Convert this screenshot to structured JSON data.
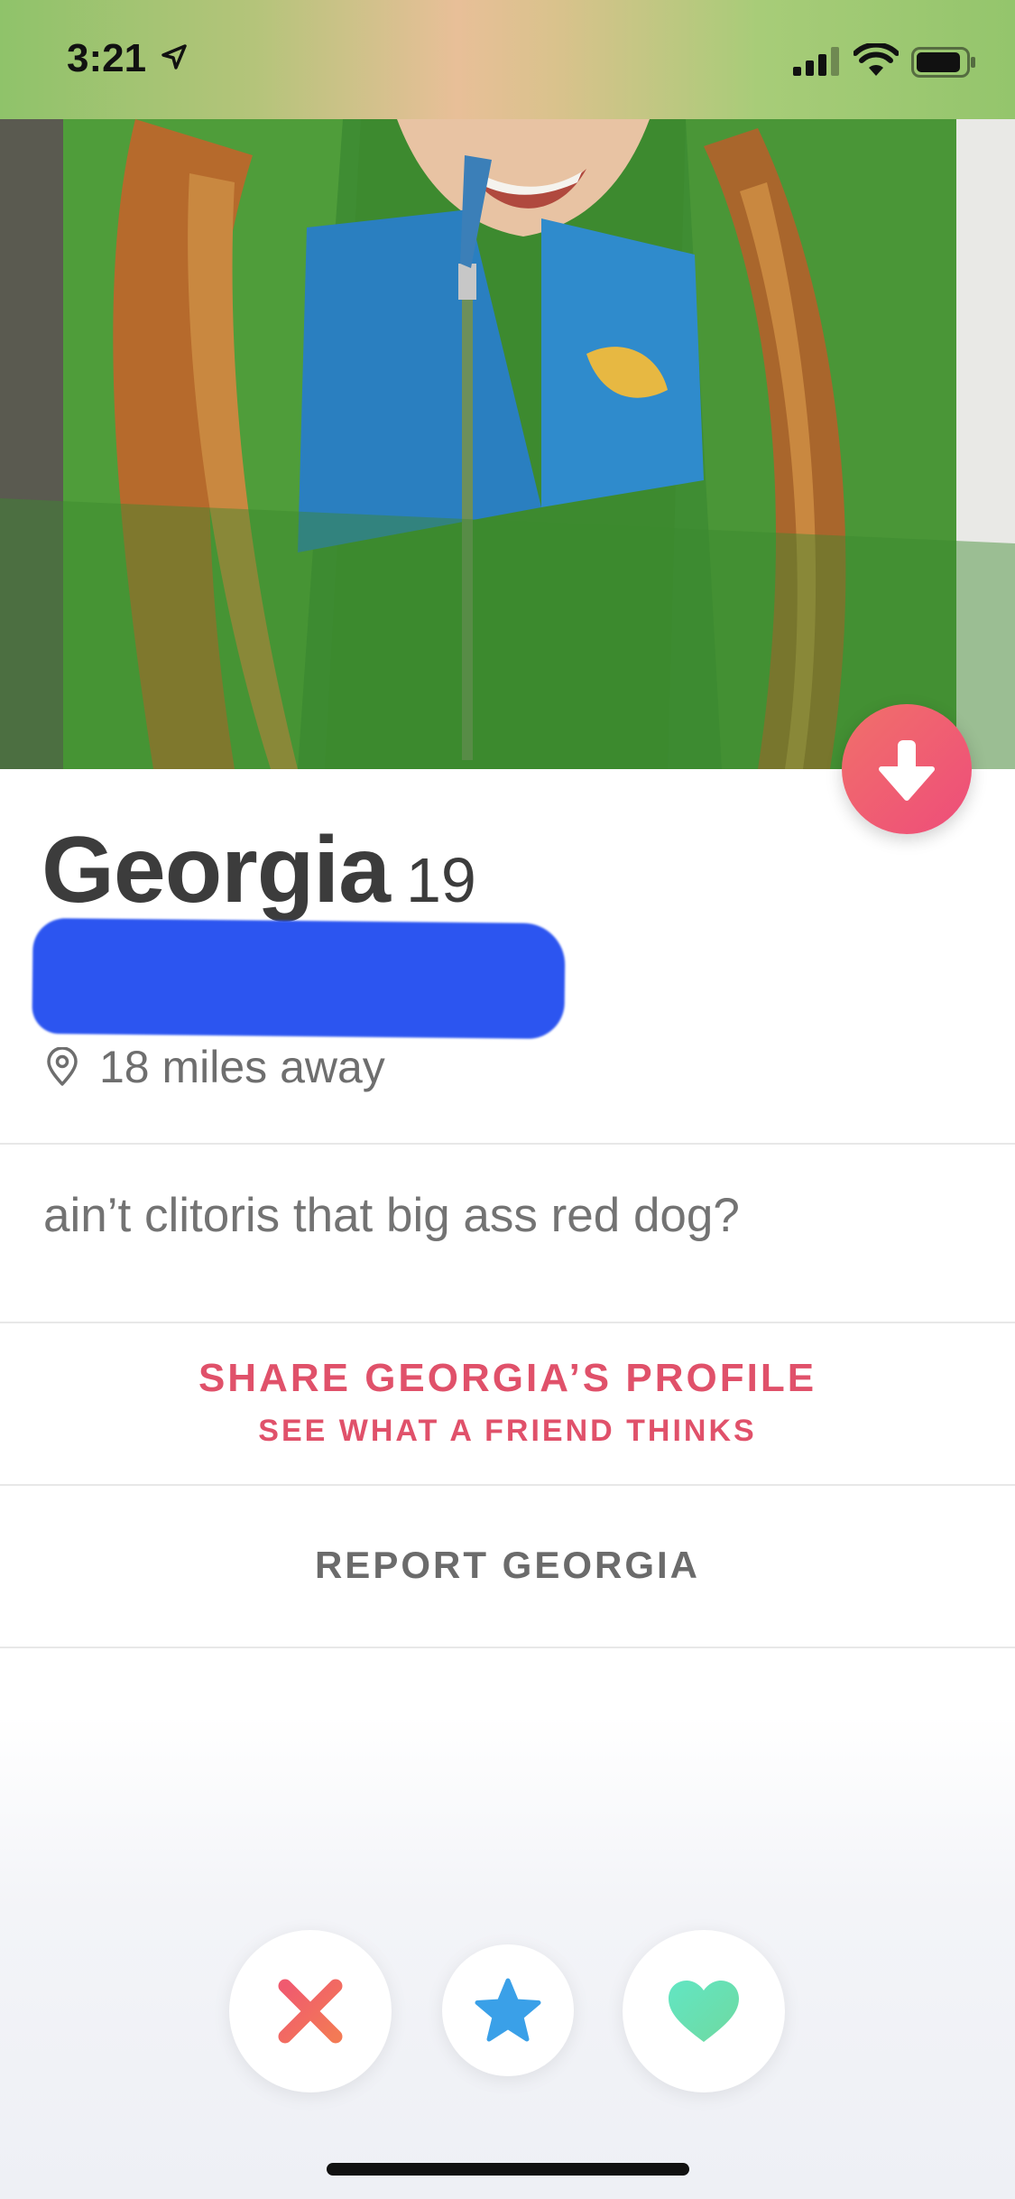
{
  "status_bar": {
    "time": "3:21",
    "icons": [
      "location-arrow-icon",
      "cellular-signal-icon",
      "wifi-icon",
      "battery-icon"
    ]
  },
  "profile": {
    "name": "Georgia",
    "age": "19",
    "distance": "18 miles away",
    "bio": "ain’t clitoris that big ass red dog?"
  },
  "actions": {
    "share_title": "SHARE GEORGIA’S PROFILE",
    "share_subtitle": "SEE WHAT A FRIEND THINKS",
    "report_label": "REPORT GEORGIA"
  },
  "colors": {
    "accent_pink": "#e0516a",
    "collapse_button_gradient": [
      "#f1706a",
      "#ee4d7a"
    ],
    "nope": "#ec5c6a",
    "superlike": "#3aa0e8",
    "like": "#5fe0b8",
    "redaction_blue": "#2c55f0"
  }
}
